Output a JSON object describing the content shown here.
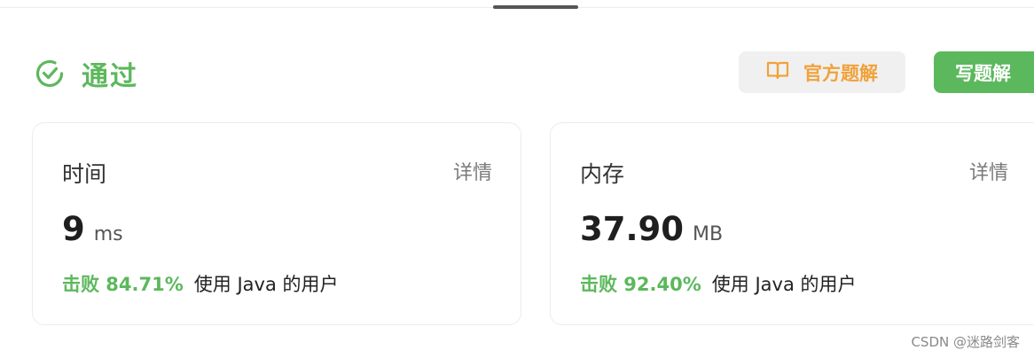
{
  "status": {
    "label": "通过",
    "color": "#5cb85c"
  },
  "buttons": {
    "official_solution": "官方题解",
    "write_solution": "写题解"
  },
  "cards": {
    "time": {
      "title": "时间",
      "detail": "详情",
      "value": "9",
      "unit": "ms",
      "beat": "击败 84.71%",
      "suffix": "使用 Java 的用户"
    },
    "memory": {
      "title": "内存",
      "detail": "详情",
      "value": "37.90",
      "unit": "MB",
      "beat": "击败 92.40%",
      "suffix": "使用 Java 的用户"
    }
  },
  "watermark": "CSDN @迷路剑客",
  "colors": {
    "accent_green": "#5cb85c",
    "accent_orange": "#f0a23a"
  },
  "icons": {
    "status": "check-circle-icon",
    "official_solution": "book-icon"
  }
}
